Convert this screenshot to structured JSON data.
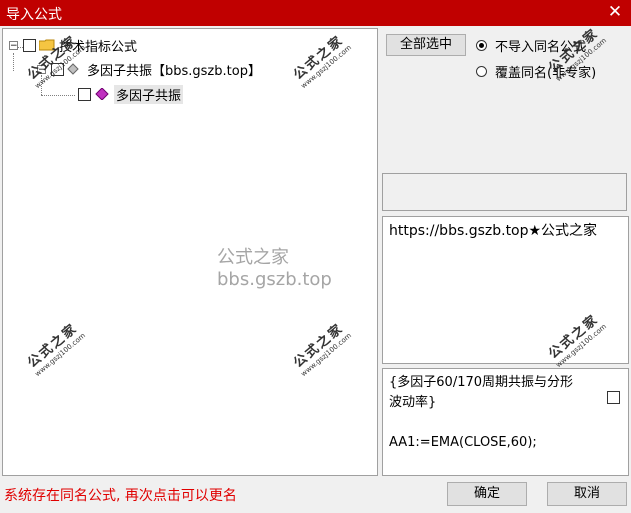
{
  "window": {
    "title": "导入公式",
    "close_glyph": "✕"
  },
  "tree": {
    "root": {
      "label": "技术指标公式",
      "expander": "−"
    },
    "group": {
      "label": "多因子共振【bbs.gszb.top】",
      "expander": "−"
    },
    "item": {
      "label": "多因子共振"
    }
  },
  "options": {
    "select_all_label": "全部选中",
    "radio_skip_label": "不导入同名公式",
    "radio_overwrite_label": "覆盖同名(非专家)"
  },
  "description": {
    "text": "https://bbs.gszb.top★公式之家"
  },
  "formula": {
    "line1": "{多因子60/170周期共振与分形",
    "line2": "波动率}",
    "line3": "AA1:=EMA(CLOSE,60);"
  },
  "watermark": {
    "center": "公式之家 bbs.gszb.top",
    "stamp_big": "公式之家",
    "stamp_small": "www.gszj100.com"
  },
  "status": {
    "message": "系统存在同名公式, 再次点击可以更名"
  },
  "buttons": {
    "ok_label": "确定",
    "cancel_label": "取消"
  },
  "colors": {
    "titlebar": "#c00000",
    "status_text": "#e00000"
  }
}
